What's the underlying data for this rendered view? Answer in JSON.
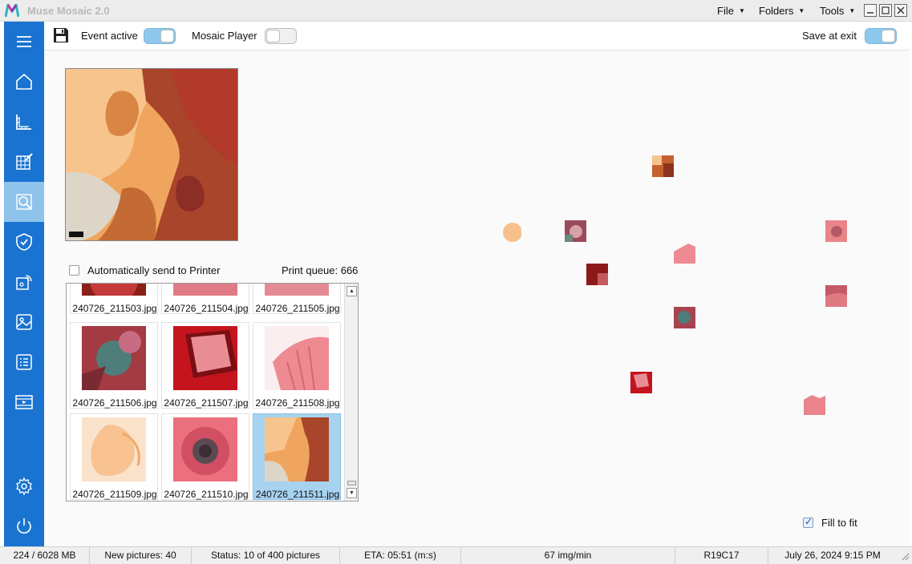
{
  "app": {
    "title": "Muse Mosaic 2.0",
    "menus": [
      {
        "label": "File"
      },
      {
        "label": "Folders"
      },
      {
        "label": "Tools"
      }
    ]
  },
  "sidebar": {
    "items": [
      {
        "name": "hamburger-menu-icon"
      },
      {
        "name": "home-icon"
      },
      {
        "name": "ruler-corner-icon"
      },
      {
        "name": "edit-grid-icon"
      },
      {
        "name": "search-image-icon",
        "active": true
      },
      {
        "name": "shield-check-icon"
      },
      {
        "name": "wireless-display-icon"
      },
      {
        "name": "image-gallery-icon"
      },
      {
        "name": "checklist-icon"
      },
      {
        "name": "video-film-icon"
      },
      {
        "name": "settings-gear-icon"
      },
      {
        "name": "power-icon"
      }
    ]
  },
  "toolbar": {
    "save_icon": "floppy-disk-icon",
    "event_active_label": "Event active",
    "event_active_on": true,
    "mosaic_player_label": "Mosaic Player",
    "mosaic_player_on": false,
    "save_at_exit_label": "Save at exit",
    "save_at_exit_on": true
  },
  "panel": {
    "auto_print_label": "Automatically send to Printer",
    "auto_print_checked": false,
    "print_queue": "Print queue: 666",
    "fill_to_fit_label": "Fill to fit",
    "fill_to_fit_checked": true
  },
  "gallery": {
    "files": [
      {
        "name": "240726_211503.jpg"
      },
      {
        "name": "240726_211504.jpg"
      },
      {
        "name": "240726_211505.jpg"
      },
      {
        "name": "240726_211506.jpg"
      },
      {
        "name": "240726_211507.jpg"
      },
      {
        "name": "240726_211508.jpg"
      },
      {
        "name": "240726_211509.jpg"
      },
      {
        "name": "240726_211510.jpg"
      },
      {
        "name": "240726_211511.jpg",
        "selected": true
      }
    ]
  },
  "statusbar": {
    "memory": "224 / 6028 MB",
    "new_pictures": "New pictures: 40",
    "status": "Status: 10 of 400 pictures",
    "eta": "ETA: 05:51 (m:s)",
    "rate": "67 img/min",
    "cell": "R19C17",
    "datetime": "July 26, 2024  9:15 PM"
  },
  "colors": {
    "sidebar": "#1a73d0",
    "sidebar_active": "#8ec3ec",
    "toggle_on": "#8ec8ec",
    "selection": "#a7d2f0"
  }
}
